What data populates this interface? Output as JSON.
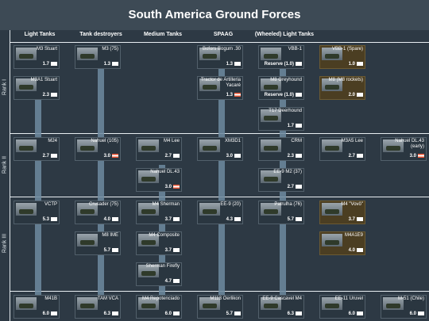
{
  "title": "South America Ground Forces",
  "headers": [
    "Light Tanks",
    "Tank destroyers",
    "Medium Tanks",
    "SPAAG",
    "(Wheeled) Light Tanks"
  ],
  "ranks": [
    "Rank I",
    "Rank II",
    "Rank III"
  ],
  "cards": [
    {
      "name": "M3 Stuart",
      "br": "1.7"
    },
    {
      "name": "M3A1 Stuart",
      "br": "2.3"
    },
    {
      "name": "M3 (75)",
      "br": "1.3"
    },
    {
      "name": "Bofors Bogum .30",
      "br": "1.3"
    },
    {
      "name": "Tractor de Artilleria Yacaré",
      "br": "1.3"
    },
    {
      "name": "VBB-1",
      "br": "Reserve (1.0)"
    },
    {
      "name": "M8 Greyhound",
      "br": "Reserve (1.0)"
    },
    {
      "name": "T17 Deerhound",
      "br": "1.7"
    },
    {
      "name": "VBB-1 (Spare)",
      "br": "1.0"
    },
    {
      "name": "M8 (M8 rockets)",
      "br": "2.0"
    },
    {
      "name": "M24",
      "br": "2.7"
    },
    {
      "name": "Nahuel (105)",
      "br": "3.0"
    },
    {
      "name": "M4 Lee",
      "br": "2.7"
    },
    {
      "name": "Nahuel DL.43",
      "br": "3.0"
    },
    {
      "name": "XM3D1",
      "br": "3.0"
    },
    {
      "name": "CRM",
      "br": "2.3"
    },
    {
      "name": "EE-9 M2 (37)",
      "br": "2.7"
    },
    {
      "name": "M3A5 Lee",
      "br": "2.7"
    },
    {
      "name": "Nahuel DL.43 (early)",
      "br": "3.0"
    },
    {
      "name": "VCTP",
      "br": "5.3"
    },
    {
      "name": "Crusader (75)",
      "br": "4.0"
    },
    {
      "name": "M4 Sherman",
      "br": "3.7"
    },
    {
      "name": "EE-9 (20)",
      "br": "4.3"
    },
    {
      "name": "Patrulha (76)",
      "br": "5.7"
    },
    {
      "name": "M4 \"Vovô\"",
      "br": "3.7"
    },
    {
      "name": "M8 IME",
      "br": "5.7"
    },
    {
      "name": "M4 Composite",
      "br": "3.7"
    },
    {
      "name": "M4A1E9",
      "br": "4.0"
    },
    {
      "name": "Sherman Firefly",
      "br": "4.7"
    },
    {
      "name": "M41B",
      "br": "6.0"
    },
    {
      "name": "TAM VCA",
      "br": "6.3"
    },
    {
      "name": "M4 Repotenciado",
      "br": "6.0"
    },
    {
      "name": "M113 Oerlikon",
      "br": "5.7"
    },
    {
      "name": "EE-9 Cascavel M4",
      "br": "6.3"
    },
    {
      "name": "EE-11 Uruvel",
      "br": "6.0"
    },
    {
      "name": "M-51 (Chile)",
      "br": "6.0"
    }
  ]
}
